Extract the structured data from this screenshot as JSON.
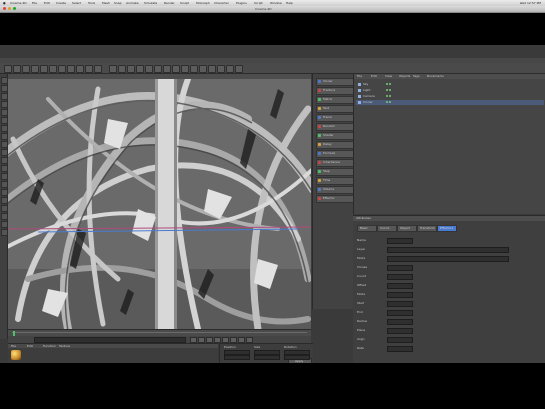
{
  "mac_menubar": {
    "items": [
      "Cinema 4D",
      "File",
      "Edit",
      "Create",
      "Select",
      "Tools",
      "Mesh",
      "Snap",
      "Animate",
      "Simulate",
      "Render",
      "Sculpt",
      "MoGraph",
      "Character",
      "Plugins",
      "Script",
      "Window",
      "Help"
    ],
    "clock": "Wed 12:57 PM"
  },
  "window": {
    "title": "Cinema 4D"
  },
  "object_tools": {
    "items": [
      "Cloner",
      "Fracture",
      "Matrix",
      "Text",
      "Tracer",
      "Random",
      "Shader",
      "Delay",
      "Formula",
      "Inheritance",
      "Step",
      "Time",
      "Volume",
      "Effector"
    ]
  },
  "object_manager": {
    "menu": [
      "File",
      "Edit",
      "View",
      "Objects",
      "Tags",
      "Bookmarks"
    ],
    "rows": [
      "Sky",
      "Light",
      "Camera",
      "Cloner"
    ]
  },
  "attributes": {
    "title": "Attributes",
    "tabs": [
      "Basic",
      "Coord.",
      "Object",
      "Transform",
      "Effectors"
    ],
    "fields": [
      "Name",
      "Layer",
      "Mode",
      "Clones",
      "Count",
      "Offset",
      "Mode",
      "Start",
      "End",
      "Radius",
      "Plane",
      "Align",
      "Rate"
    ]
  },
  "material_manager": {
    "menu": [
      "File",
      "Edit",
      "Function",
      "Texture"
    ],
    "material_name": "Mat"
  },
  "coordinates": {
    "headers": [
      "Position",
      "Size",
      "Rotation"
    ],
    "apply": "Apply"
  },
  "colors": {
    "accent": "#4a7bd0",
    "viewport_bg": "#6b6b6b",
    "ui_bg": "#3a3a3a"
  }
}
